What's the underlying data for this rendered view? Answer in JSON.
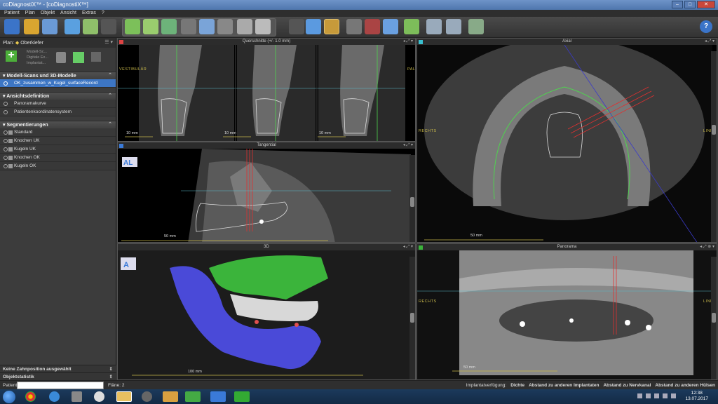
{
  "window": {
    "title": "coDiagnostiX™ - [coDiagnostiX™]"
  },
  "menu": [
    "Patient",
    "Plan",
    "Objekt",
    "Ansicht",
    "Extras",
    "?"
  ],
  "left_panel": {
    "plan_label": "Plan:",
    "plan_value": "Oberkiefer",
    "actions": [
      "Modell-Sc...",
      "Digitale Ex...",
      "Implantat..."
    ],
    "sections": [
      {
        "title": "Modell-Scans und 3D-Modelle",
        "items": [
          {
            "label": "OK_zusammen_w_Kugel_surfaceRecord",
            "selected": true
          }
        ]
      },
      {
        "title": "Ansichtsdefinition",
        "items": [
          {
            "label": "Panoramakurve"
          },
          {
            "label": "Patientenkoordinatensystem"
          }
        ]
      },
      {
        "title": "Segmentierungen",
        "items": [
          {
            "label": "Standard"
          },
          {
            "label": "Knochen UK"
          },
          {
            "label": "Kugeln UK"
          },
          {
            "label": "Knochen OK"
          },
          {
            "label": "Kugeln OK"
          }
        ]
      }
    ],
    "bottom": [
      "Keine Zahnposition ausgewählt",
      "Objektstatistik"
    ]
  },
  "views": {
    "cross_sections": {
      "title": "Querschnitte (+/- 1.0 mm)",
      "scale": "10 mm",
      "left_orient": "VESTIBULÄR",
      "right_orient": "PALATINAL"
    },
    "axial": {
      "title": "Axial",
      "scale": "50 mm",
      "left_orient": "RECHTS",
      "right_orient": "LINKS"
    },
    "tangential": {
      "title": "Tangential",
      "scale": "50 mm"
    },
    "three_d": {
      "title": "3D",
      "scale": "100 mm"
    },
    "panorama": {
      "title": "Panorama",
      "scale": "50 mm",
      "left_orient": "RECHTS",
      "right_orient": "LINKS"
    }
  },
  "status": {
    "patient_label": "Patient",
    "plane_label": "Fläne: 2",
    "right": [
      "Implantatverfügung:",
      "Dichte",
      "Abstand zu anderen Implantaten",
      "Abstand zu Nervkanal",
      "Abstand zu anderen Hülsen"
    ]
  },
  "taskbar": {
    "time": "12:38",
    "date": "13.07.2017"
  },
  "colors": {
    "accent": "#3d76c4",
    "model_green": "#3bb43b",
    "model_blue": "#4a4ad8",
    "nerve_red": "#e03030"
  }
}
